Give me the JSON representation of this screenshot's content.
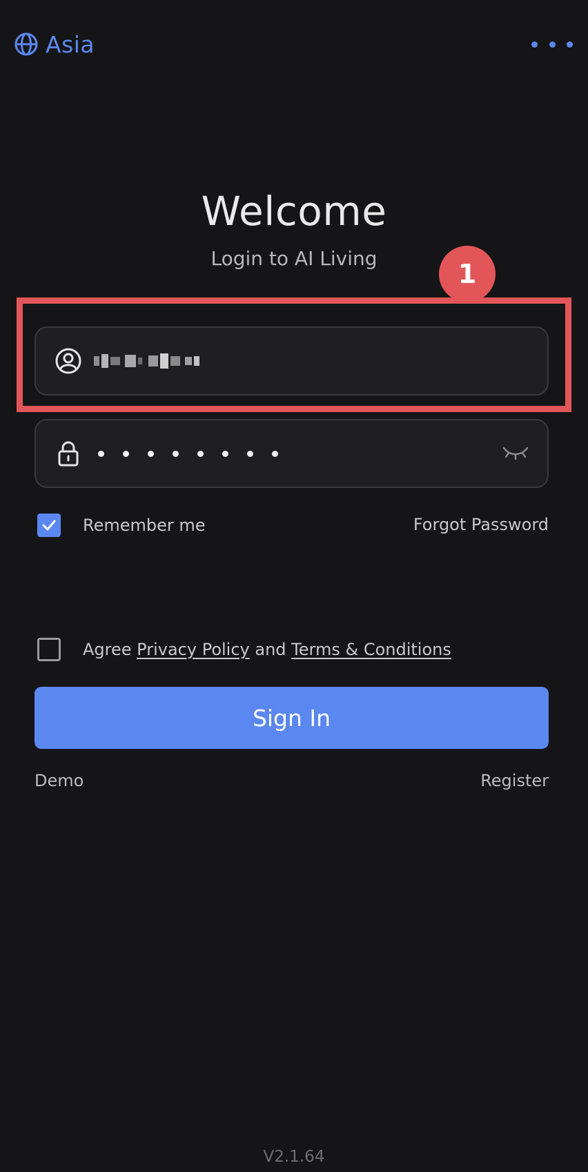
{
  "top_bar": {
    "region_icon": "globe-icon",
    "region_label": "Asia",
    "more_icon": "more-horizontal-icon"
  },
  "header": {
    "title": "Welcome",
    "subtitle": "Login to AI Living"
  },
  "annotation": {
    "badge_number": "1",
    "color": "#e25659"
  },
  "form": {
    "username": {
      "icon": "user-circle-icon",
      "value_obscured": true
    },
    "password": {
      "icon": "lock-icon",
      "masked_length": 8,
      "toggle_icon": "eye-closed-icon"
    },
    "remember_me": {
      "label": "Remember me",
      "checked": true
    },
    "forgot_password": "Forgot Password",
    "agree": {
      "checked": false,
      "prefix": "Agree",
      "privacy_policy": "Privacy Policy",
      "conjunction": "and",
      "terms": "Terms & Conditions"
    },
    "sign_in_label": "Sign In"
  },
  "footer_links": {
    "demo": "Demo",
    "register": "Register"
  },
  "version": "V2.1.64",
  "colors": {
    "accent": "#5b87f0",
    "background": "#151517",
    "field_bg": "#1f1f22"
  }
}
